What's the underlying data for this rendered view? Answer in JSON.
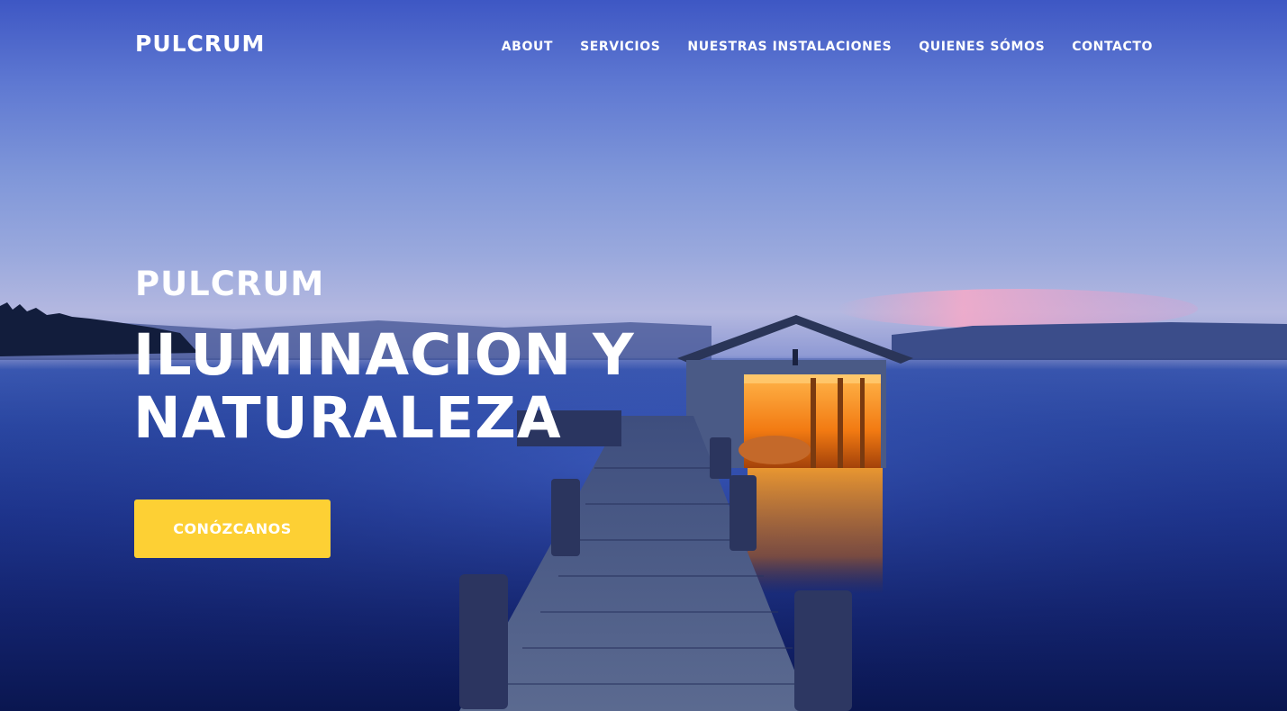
{
  "header": {
    "brand": "PULCRUM",
    "nav": [
      "ABOUT",
      "SERVICIOS",
      "NUESTRAS INSTALACIONES",
      "QUIENES SÓMOS",
      "CONTACTO"
    ]
  },
  "hero": {
    "subtitle": "PULCRUM",
    "title": "ILUMINACION Y NATURALEZA",
    "cta": "CONÓZCANOS",
    "background_image": "dock-boathouse-lake-dusk"
  },
  "colors": {
    "cta_background": "#fdd034",
    "text": "#ffffff",
    "sky": "#5f79d2",
    "water": "#13236e"
  }
}
